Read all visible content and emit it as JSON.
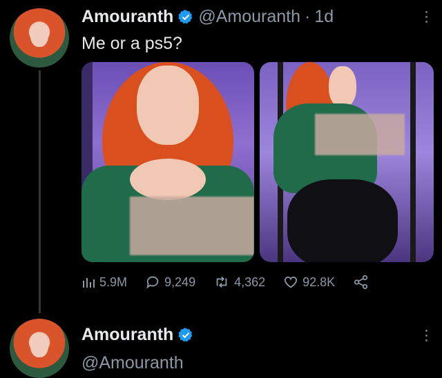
{
  "tweet": {
    "author_name": "Amouranth",
    "handle": "@Amouranth",
    "time": "1d",
    "text": "Me or a ps5?",
    "views": "5.9M",
    "replies": "9,249",
    "retweets": "4,362",
    "likes": "92.8K",
    "icons": [
      "views-icon",
      "reply-icon",
      "retweet-icon",
      "like-icon",
      "share-icon",
      "verified-badge-icon",
      "more-icon"
    ]
  },
  "reply_preview": {
    "author_name": "Amouranth",
    "handle": "@Amouranth"
  },
  "colors": {
    "background": "#000000",
    "primary_text": "#e7e9ea",
    "secondary_text": "#8b98a5",
    "verified": "#1d9bf0"
  }
}
